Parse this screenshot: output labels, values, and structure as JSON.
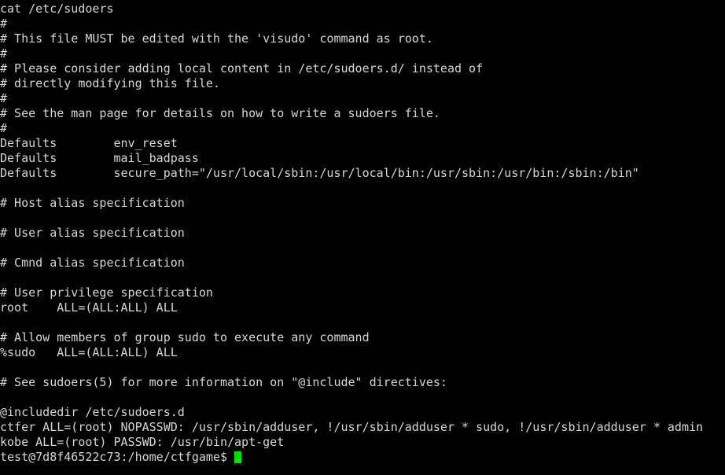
{
  "terminal": {
    "background_color": "#000000",
    "foreground_color": "#d6d6d6",
    "cursor_color": "#00e000",
    "command": "cat /etc/sudoers",
    "lines": [
      "cat /etc/sudoers",
      "#",
      "# This file MUST be edited with the 'visudo' command as root.",
      "#",
      "# Please consider adding local content in /etc/sudoers.d/ instead of",
      "# directly modifying this file.",
      "#",
      "# See the man page for details on how to write a sudoers file.",
      "#",
      "Defaults        env_reset",
      "Defaults        mail_badpass",
      "Defaults        secure_path=\"/usr/local/sbin:/usr/local/bin:/usr/sbin:/usr/bin:/sbin:/bin\"",
      "",
      "# Host alias specification",
      "",
      "# User alias specification",
      "",
      "# Cmnd alias specification",
      "",
      "# User privilege specification",
      "root    ALL=(ALL:ALL) ALL",
      "",
      "# Allow members of group sudo to execute any command",
      "%sudo   ALL=(ALL:ALL) ALL",
      "",
      "# See sudoers(5) for more information on \"@include\" directives:",
      "",
      "@includedir /etc/sudoers.d",
      "ctfer ALL=(root) NOPASSWD: /usr/sbin/adduser, !/usr/sbin/adduser * sudo, !/usr/sbin/adduser * admin",
      "kobe ALL=(root) PASSWD: /usr/bin/apt-get"
    ],
    "prompt": {
      "user": "test",
      "host": "7d8f46522c73",
      "path": "/home/ctfgame",
      "symbol": "$",
      "full": "test@7d8f46522c73:/home/ctfgame$ "
    }
  }
}
